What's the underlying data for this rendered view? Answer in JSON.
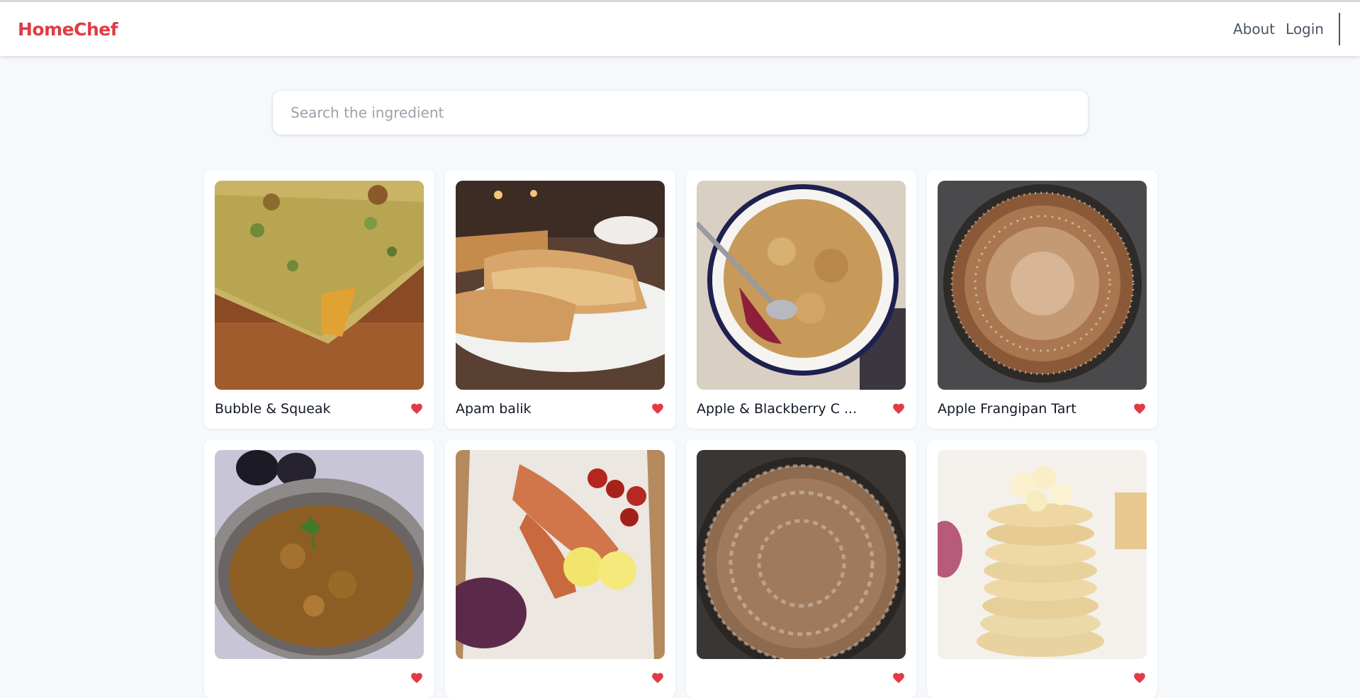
{
  "header": {
    "brand": "HomeChef",
    "nav": [
      {
        "label": "About"
      },
      {
        "label": "Login"
      }
    ]
  },
  "search": {
    "placeholder": "Search the ingredient",
    "value": ""
  },
  "colors": {
    "brand": "#e23b45",
    "heart": "#e23b45",
    "background": "#f6f9fc",
    "card": "#ffffff"
  },
  "recipes": [
    {
      "title": "Bubble & Squeak",
      "favorite_icon": "heart-icon"
    },
    {
      "title": "Apam balik",
      "favorite_icon": "heart-icon"
    },
    {
      "title": "Apple & Blackberry C ...",
      "favorite_icon": "heart-icon"
    },
    {
      "title": "Apple Frangipan Tart",
      "favorite_icon": "heart-icon"
    },
    {
      "title": "",
      "favorite_icon": "heart-icon"
    },
    {
      "title": "",
      "favorite_icon": "heart-icon"
    },
    {
      "title": "",
      "favorite_icon": "heart-icon"
    },
    {
      "title": "",
      "favorite_icon": "heart-icon"
    }
  ]
}
